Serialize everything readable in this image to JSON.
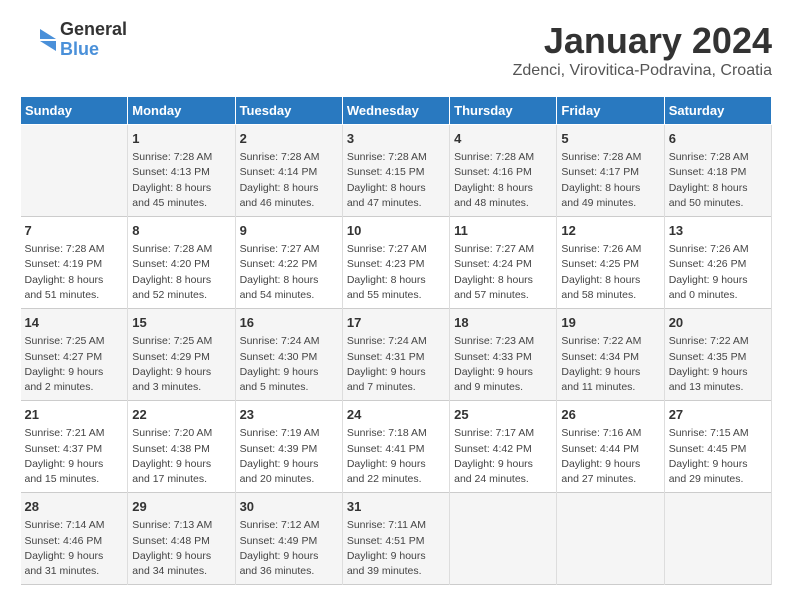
{
  "header": {
    "logo_line1": "General",
    "logo_line2": "Blue",
    "month": "January 2024",
    "location": "Zdenci, Virovitica-Podravina, Croatia"
  },
  "weekdays": [
    "Sunday",
    "Monday",
    "Tuesday",
    "Wednesday",
    "Thursday",
    "Friday",
    "Saturday"
  ],
  "weeks": [
    [
      {
        "day": "",
        "info": ""
      },
      {
        "day": "1",
        "info": "Sunrise: 7:28 AM\nSunset: 4:13 PM\nDaylight: 8 hours\nand 45 minutes."
      },
      {
        "day": "2",
        "info": "Sunrise: 7:28 AM\nSunset: 4:14 PM\nDaylight: 8 hours\nand 46 minutes."
      },
      {
        "day": "3",
        "info": "Sunrise: 7:28 AM\nSunset: 4:15 PM\nDaylight: 8 hours\nand 47 minutes."
      },
      {
        "day": "4",
        "info": "Sunrise: 7:28 AM\nSunset: 4:16 PM\nDaylight: 8 hours\nand 48 minutes."
      },
      {
        "day": "5",
        "info": "Sunrise: 7:28 AM\nSunset: 4:17 PM\nDaylight: 8 hours\nand 49 minutes."
      },
      {
        "day": "6",
        "info": "Sunrise: 7:28 AM\nSunset: 4:18 PM\nDaylight: 8 hours\nand 50 minutes."
      }
    ],
    [
      {
        "day": "7",
        "info": "Sunrise: 7:28 AM\nSunset: 4:19 PM\nDaylight: 8 hours\nand 51 minutes."
      },
      {
        "day": "8",
        "info": "Sunrise: 7:28 AM\nSunset: 4:20 PM\nDaylight: 8 hours\nand 52 minutes."
      },
      {
        "day": "9",
        "info": "Sunrise: 7:27 AM\nSunset: 4:22 PM\nDaylight: 8 hours\nand 54 minutes."
      },
      {
        "day": "10",
        "info": "Sunrise: 7:27 AM\nSunset: 4:23 PM\nDaylight: 8 hours\nand 55 minutes."
      },
      {
        "day": "11",
        "info": "Sunrise: 7:27 AM\nSunset: 4:24 PM\nDaylight: 8 hours\nand 57 minutes."
      },
      {
        "day": "12",
        "info": "Sunrise: 7:26 AM\nSunset: 4:25 PM\nDaylight: 8 hours\nand 58 minutes."
      },
      {
        "day": "13",
        "info": "Sunrise: 7:26 AM\nSunset: 4:26 PM\nDaylight: 9 hours\nand 0 minutes."
      }
    ],
    [
      {
        "day": "14",
        "info": "Sunrise: 7:25 AM\nSunset: 4:27 PM\nDaylight: 9 hours\nand 2 minutes."
      },
      {
        "day": "15",
        "info": "Sunrise: 7:25 AM\nSunset: 4:29 PM\nDaylight: 9 hours\nand 3 minutes."
      },
      {
        "day": "16",
        "info": "Sunrise: 7:24 AM\nSunset: 4:30 PM\nDaylight: 9 hours\nand 5 minutes."
      },
      {
        "day": "17",
        "info": "Sunrise: 7:24 AM\nSunset: 4:31 PM\nDaylight: 9 hours\nand 7 minutes."
      },
      {
        "day": "18",
        "info": "Sunrise: 7:23 AM\nSunset: 4:33 PM\nDaylight: 9 hours\nand 9 minutes."
      },
      {
        "day": "19",
        "info": "Sunrise: 7:22 AM\nSunset: 4:34 PM\nDaylight: 9 hours\nand 11 minutes."
      },
      {
        "day": "20",
        "info": "Sunrise: 7:22 AM\nSunset: 4:35 PM\nDaylight: 9 hours\nand 13 minutes."
      }
    ],
    [
      {
        "day": "21",
        "info": "Sunrise: 7:21 AM\nSunset: 4:37 PM\nDaylight: 9 hours\nand 15 minutes."
      },
      {
        "day": "22",
        "info": "Sunrise: 7:20 AM\nSunset: 4:38 PM\nDaylight: 9 hours\nand 17 minutes."
      },
      {
        "day": "23",
        "info": "Sunrise: 7:19 AM\nSunset: 4:39 PM\nDaylight: 9 hours\nand 20 minutes."
      },
      {
        "day": "24",
        "info": "Sunrise: 7:18 AM\nSunset: 4:41 PM\nDaylight: 9 hours\nand 22 minutes."
      },
      {
        "day": "25",
        "info": "Sunrise: 7:17 AM\nSunset: 4:42 PM\nDaylight: 9 hours\nand 24 minutes."
      },
      {
        "day": "26",
        "info": "Sunrise: 7:16 AM\nSunset: 4:44 PM\nDaylight: 9 hours\nand 27 minutes."
      },
      {
        "day": "27",
        "info": "Sunrise: 7:15 AM\nSunset: 4:45 PM\nDaylight: 9 hours\nand 29 minutes."
      }
    ],
    [
      {
        "day": "28",
        "info": "Sunrise: 7:14 AM\nSunset: 4:46 PM\nDaylight: 9 hours\nand 31 minutes."
      },
      {
        "day": "29",
        "info": "Sunrise: 7:13 AM\nSunset: 4:48 PM\nDaylight: 9 hours\nand 34 minutes."
      },
      {
        "day": "30",
        "info": "Sunrise: 7:12 AM\nSunset: 4:49 PM\nDaylight: 9 hours\nand 36 minutes."
      },
      {
        "day": "31",
        "info": "Sunrise: 7:11 AM\nSunset: 4:51 PM\nDaylight: 9 hours\nand 39 minutes."
      },
      {
        "day": "",
        "info": ""
      },
      {
        "day": "",
        "info": ""
      },
      {
        "day": "",
        "info": ""
      }
    ]
  ]
}
